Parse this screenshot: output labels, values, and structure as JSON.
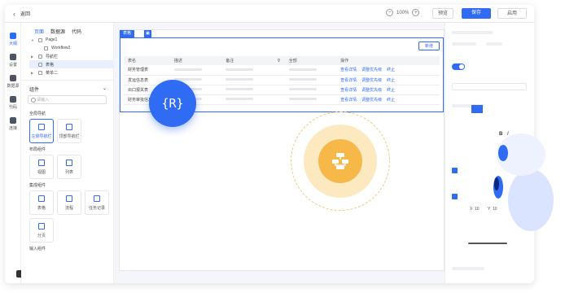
{
  "topbar": {
    "back_label": "返回",
    "zoom": "100%",
    "zoom_minus": "−",
    "zoom_plus": "+",
    "preview_label": "预览",
    "save_label": "保存",
    "publish_label": "启用"
  },
  "rail": [
    {
      "label": "大纲",
      "active": true
    },
    {
      "label": "设置"
    },
    {
      "label": "数据源"
    },
    {
      "label": "代码"
    },
    {
      "label": "连接"
    }
  ],
  "left": {
    "tabs": [
      "页面",
      "数据源",
      "代码"
    ],
    "tree": [
      {
        "label": "Page1",
        "level": 0
      },
      {
        "label": "Workflow2",
        "level": 1
      },
      {
        "label": "导航栏",
        "level": 0
      },
      {
        "label": "表格",
        "level": 0,
        "selected": true
      },
      {
        "label": "菜单二",
        "level": 0
      }
    ],
    "components_title": "组件",
    "search_placeholder": "请输入",
    "groups": [
      {
        "title": "全局导航",
        "items": [
          "左侧导航栏",
          "顶部导航栏"
        ]
      },
      {
        "title": "布局组件",
        "items": [
          "视图",
          "列表"
        ]
      },
      {
        "title": "集成组件",
        "items": [
          "表格",
          "流程",
          "任务记录",
          "分页"
        ]
      },
      {
        "title": "输入组件"
      }
    ]
  },
  "canvas": {
    "tag_label": "表格",
    "add_button": "新增",
    "columns": [
      "表名",
      "描述",
      "备注",
      "",
      "全部",
      "操作"
    ],
    "rows": [
      {
        "name": "财务管理表"
      },
      {
        "name": "发运信息表"
      },
      {
        "name": "出口报关表"
      },
      {
        "name": "财务审批信息"
      }
    ],
    "actions": [
      "查看详情",
      "调整优先级",
      "终止"
    ]
  },
  "badge_label": "{R}",
  "right": {
    "format": [
      "B",
      "I",
      "←"
    ],
    "x_label": "X",
    "x_value": "10",
    "y_label": "Y",
    "y_value": "10"
  },
  "colors": {
    "accent": "#2f6bf3",
    "orange": "#f7b84a"
  }
}
